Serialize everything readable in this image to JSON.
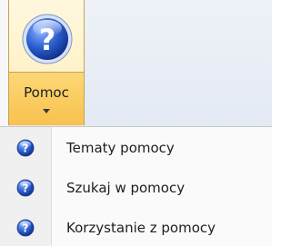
{
  "ribbon": {
    "help_button": {
      "label": "Pomoc",
      "icon": "help-circle-icon"
    }
  },
  "menu": {
    "items": [
      {
        "label": "Tematy pomocy",
        "icon": "help-circle-icon"
      },
      {
        "label": "Szukaj w pomocy",
        "icon": "help-circle-icon"
      },
      {
        "label": "Korzystanie z pomocy",
        "icon": "help-circle-icon"
      }
    ]
  },
  "colors": {
    "accent_blue": "#1f4fb8",
    "button_hover": "#ffe8a6",
    "button_pressed": "#f8c24e"
  }
}
